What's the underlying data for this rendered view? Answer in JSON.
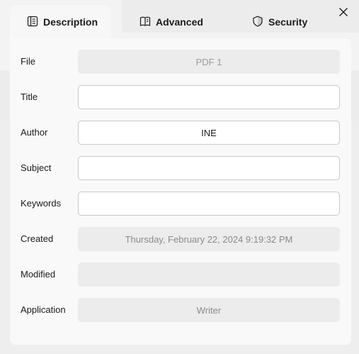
{
  "tabs": [
    {
      "label": "Description",
      "icon": "description-icon",
      "active": true
    },
    {
      "label": "Advanced",
      "icon": "book-icon",
      "active": false
    },
    {
      "label": "Security",
      "icon": "shield-icon",
      "active": false
    }
  ],
  "close_icon": "close-icon",
  "fields": {
    "file": {
      "label": "File",
      "value": ""
    },
    "title": {
      "label": "Title",
      "value": ""
    },
    "author": {
      "label": "Author",
      "value": "INE"
    },
    "subject": {
      "label": "Subject",
      "value": ""
    },
    "keywords": {
      "label": "Keywords",
      "value": ""
    },
    "created": {
      "label": "Created",
      "value": "Thursday, February 22, 2024 9:19:32 PM"
    },
    "modified": {
      "label": "Modified",
      "value": ""
    },
    "application": {
      "label": "Application",
      "value": "Writer"
    }
  },
  "file_placeholder": "PDF 1",
  "colors": {
    "accent": "#1b1b1b",
    "background": "#f3f3f3",
    "panel": "#f9f9f9"
  }
}
